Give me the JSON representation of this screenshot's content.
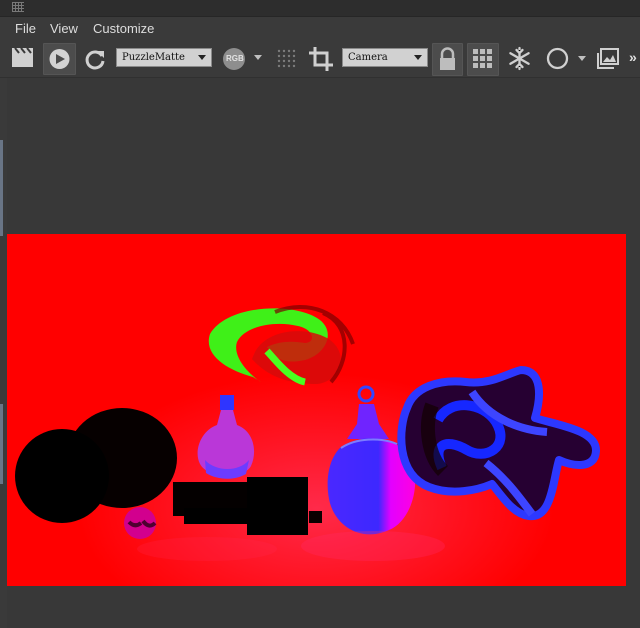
{
  "menu": {
    "file": "File",
    "view": "View",
    "customize": "Customize"
  },
  "toolbar": {
    "render_element": {
      "selected": "PuzzleMatte"
    },
    "rgb_label": "RGB",
    "view_mode": {
      "selected": "Camera"
    },
    "overflow_label": "»"
  },
  "icons": [
    "grip-icon",
    "clapperboard-icon",
    "play-icon",
    "refresh-icon",
    "rgb-channel-icon",
    "dotted-grid-icon",
    "crop-icon",
    "lock-icon",
    "grid-icon",
    "snowflake-icon",
    "circle-icon",
    "image-icon"
  ],
  "colors": {
    "background": "#3a3a3a",
    "toolbar": "#3a3a3a",
    "combo_background": "#d1d1d1",
    "render_background": "#ff0000",
    "puzzle_green": "#3eff10",
    "puzzle_blue": "#1f2fff",
    "puzzle_magenta": "#ff00ff"
  }
}
